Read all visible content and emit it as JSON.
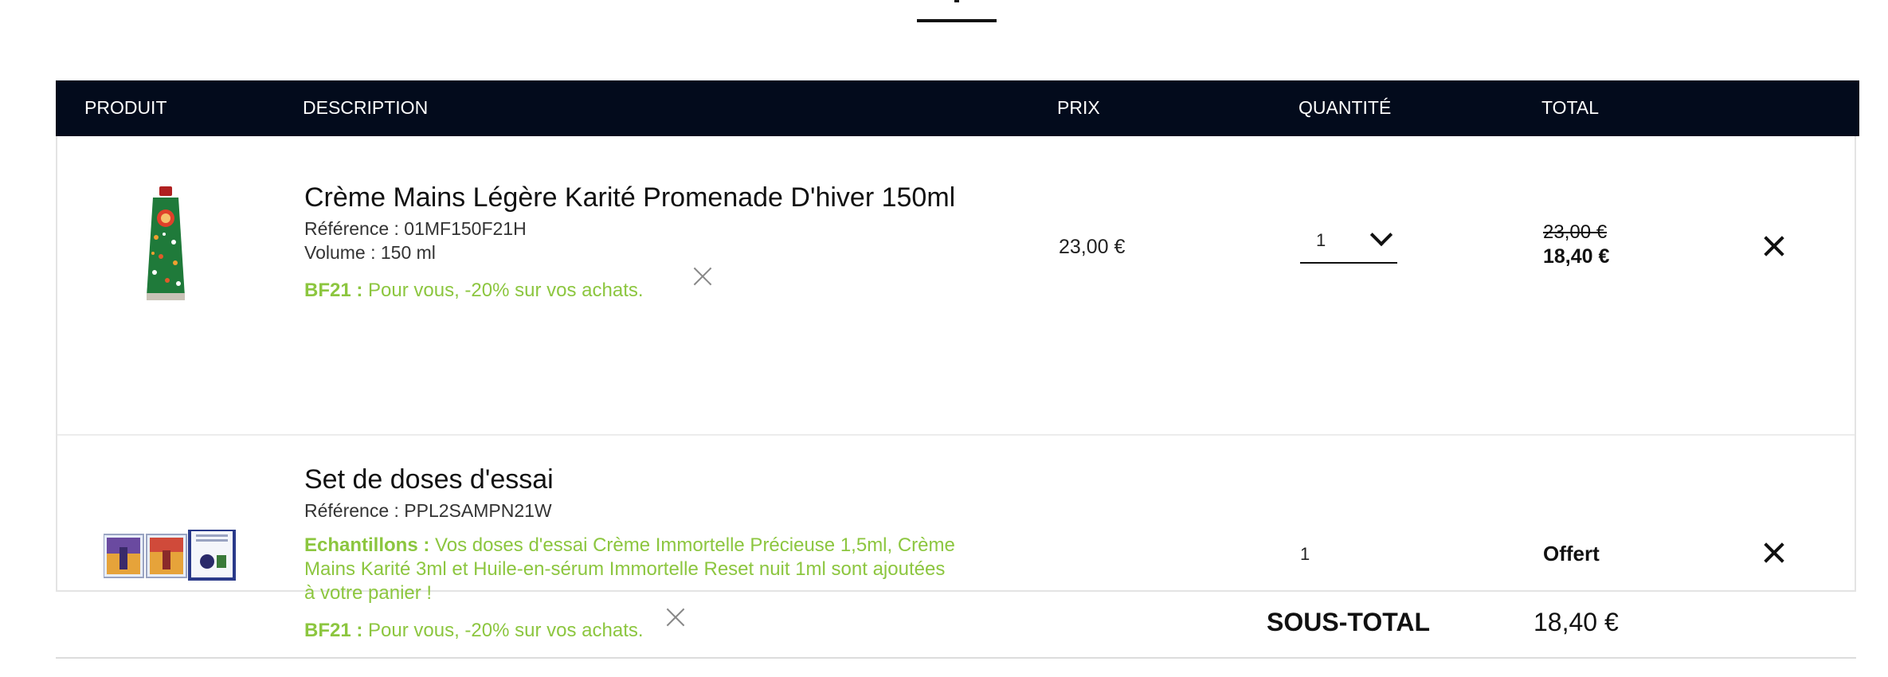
{
  "table": {
    "headers": {
      "product": "PRODUIT",
      "description": "DESCRIPTION",
      "price": "PRIX",
      "quantity": "QUANTITÉ",
      "total": "TOTAL"
    }
  },
  "items": [
    {
      "image_icon": "hand-cream-tube-icon",
      "title": "Crème Mains Légère Karité Promenade D'hiver 150ml",
      "reference": "Référence : 01MF150F21H",
      "volume": "Volume : 150 ml",
      "promo_code": "BF21 :",
      "promo_text": "Pour vous, -20% sur vos achats.",
      "price": "23,00 €",
      "quantity": "1",
      "total_old": "23,00 €",
      "total_new": "18,40 €"
    },
    {
      "image_icon": "sample-set-icon",
      "title": "Set de doses d'essai",
      "reference": "Référence : PPL2SAMPN21W",
      "samples_label": "Echantillons :",
      "samples_line1": "Vos doses d'essai Crème Immortelle Précieuse 1,5ml, Crème",
      "samples_line2": "Mains Karité 3ml et Huile-en-sérum Immortelle Reset nuit 1ml sont ajoutées",
      "samples_line3": "à votre panier !",
      "promo_code": "BF21 :",
      "promo_text": "Pour vous, -20% sur vos achats.",
      "quantity": "1",
      "total": "Offert"
    }
  ],
  "summary": {
    "subtotal_label": "SOUS-TOTAL",
    "subtotal_value": "18,40 €"
  },
  "colors": {
    "header_bg": "#030b1c",
    "promo_green": "#8cc63f"
  }
}
